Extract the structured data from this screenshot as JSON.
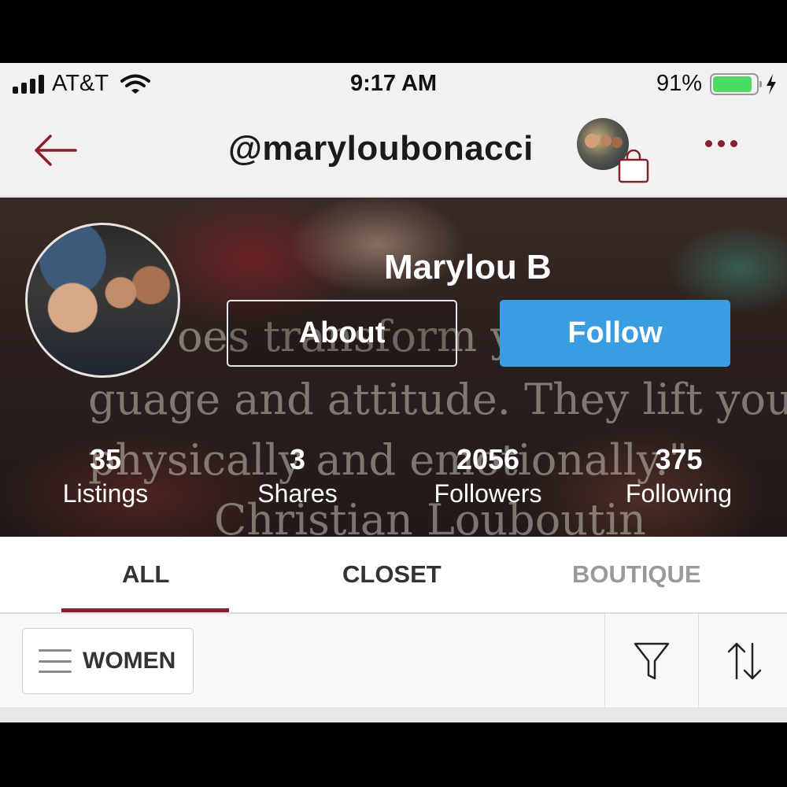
{
  "status_bar": {
    "carrier": "AT&T",
    "time": "9:17 AM",
    "battery_percent": "91%",
    "battery_level": 0.91,
    "signal_bars": 4
  },
  "nav": {
    "handle": "@maryloubonacci",
    "back_icon": "arrow-left-icon",
    "bag_icon": "shopping-bag-icon",
    "more_icon": "ellipsis-icon",
    "accent_color": "#8b1e2c"
  },
  "profile": {
    "display_name": "Marylou B",
    "about_label": "About",
    "follow_label": "Follow",
    "follow_color": "#3a9de1",
    "banner_quote": [
      "oes transform yo",
      "guage and attitude. They lift you",
      "physically and emotionally.\"",
      "Christian Louboutin"
    ],
    "stats": [
      {
        "value": "35",
        "label": "Listings"
      },
      {
        "value": "3",
        "label": "Shares"
      },
      {
        "value": "2056",
        "label": "Followers"
      },
      {
        "value": "375",
        "label": "Following"
      }
    ]
  },
  "tabs": [
    {
      "label": "ALL",
      "active": true
    },
    {
      "label": "CLOSET",
      "active": false
    },
    {
      "label": "BOUTIQUE",
      "active": false
    }
  ],
  "filter_bar": {
    "department_label": "WOMEN",
    "filter_icon": "filter-funnel-icon",
    "sort_icon": "sort-arrows-icon"
  }
}
